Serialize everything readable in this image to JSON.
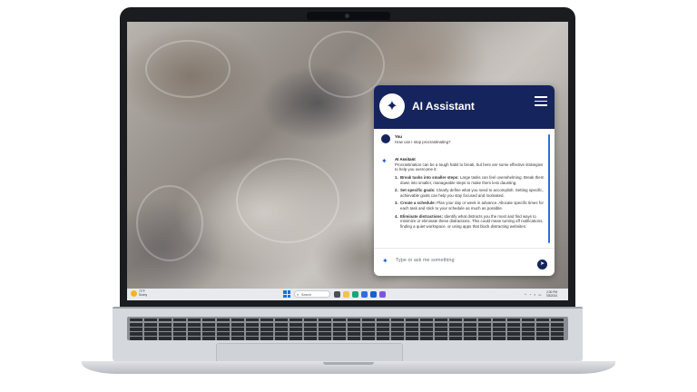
{
  "assistant": {
    "title": "AI Assistant",
    "user_message": {
      "sender": "You",
      "text": "How can I stop procrastinating?"
    },
    "ai_message": {
      "sender": "AI Assitant",
      "intro": "Procrastination can be a tough habit to break, but here are some effective strategies to help you overcome it:",
      "steps": [
        {
          "num": "1.",
          "title": "Break tasks into smaller steps:",
          "text": "Large tasks can feel overwhelming. Break them down into smaller, manageable steps to make them less daunting."
        },
        {
          "num": "2.",
          "title": "Set specific goals:",
          "text": "Clearly define what you need to accomplish. Setting specific, achievable goals can help you stay focused and motivated."
        },
        {
          "num": "3.",
          "title": "Create a schedule:",
          "text": "Plan your day or week in advance. Allocate specific times for each task and stick to your schedule as much as possible."
        },
        {
          "num": "4.",
          "title": "Eliminate distractions:",
          "text": "Identify what distracts you the most and find ways to minimize or eliminate these distractions. This could mean turning off notifications, finding a quiet workspace, or using apps that block distracting websites."
        }
      ]
    },
    "input_placeholder": "Type or ask me something",
    "icons": {
      "logo": "sparkle-icon",
      "menu": "hamburger-menu-icon",
      "send": "send-icon"
    },
    "accent_color": "#15245c"
  },
  "taskbar": {
    "weather_temp": "72°F",
    "weather_desc": "Sunny",
    "search_label": "Search",
    "time": "2:30 PM",
    "date": "7/8/2024"
  }
}
